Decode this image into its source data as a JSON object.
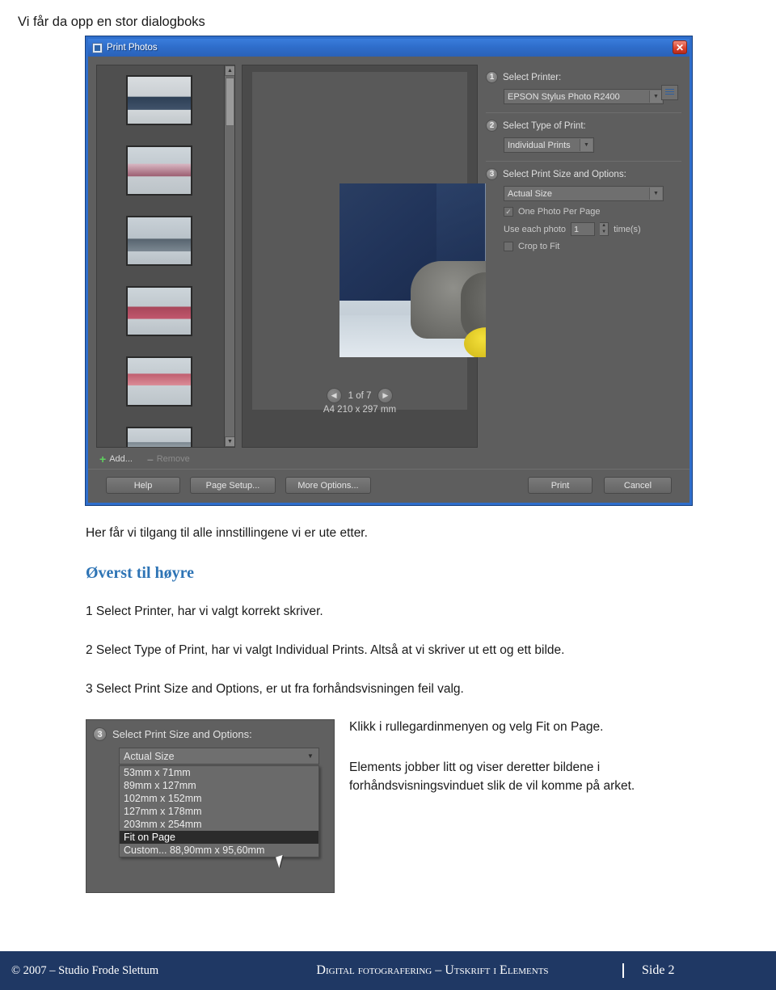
{
  "top_heading": "Vi får da opp en stor dialogboks",
  "dialog": {
    "title": "Print Photos",
    "close_label": "✕",
    "filmstrip": {
      "add_label": "Add...",
      "remove_label": "Remove"
    },
    "preview": {
      "page_indicator": "1 of 7",
      "page_size": "A4 210 x 297 mm",
      "prev_arrow": "◀",
      "next_arrow": "▶"
    },
    "sections": [
      {
        "number": "1",
        "title": "Select Printer:",
        "value": "EPSON Stylus Photo R2400"
      },
      {
        "number": "2",
        "title": "Select Type of Print:",
        "value": "Individual Prints"
      },
      {
        "number": "3",
        "title": "Select Print Size and Options:",
        "value": "Actual Size",
        "options": [
          {
            "label": "One Photo Per Page",
            "checked": "✓"
          },
          {
            "label": "Use each photo",
            "value": "1",
            "suffix": "time(s)"
          },
          {
            "label": "Crop to Fit",
            "checked": ""
          }
        ]
      }
    ],
    "buttons": {
      "help": "Help",
      "page_setup": "Page Setup...",
      "more_options": "More Options...",
      "print": "Print",
      "cancel": "Cancel"
    }
  },
  "body": {
    "p1": "Her får vi tilgang til alle innstillingene vi er ute etter.",
    "blue_heading": "Øverst til høyre",
    "p2": "1 Select Printer, har vi valgt korrekt skriver.",
    "p3": "2 Select Type of Print, har vi valgt Individual Prints. Altså at vi skriver ut ett og ett bilde.",
    "p4": "3 Select Print Size and Options, er ut fra forhåndsvisningen feil valg."
  },
  "dropdown_shot": {
    "number": "3",
    "title": "Select Print Size and Options:",
    "selected_value": "Actual Size",
    "items": [
      "53mm x 71mm",
      "89mm x 127mm",
      "102mm x 152mm",
      "127mm x 178mm",
      "203mm x 254mm",
      "Fit on Page",
      "Custom... 88,90mm x 95,60mm"
    ],
    "highlighted": "Fit on Page"
  },
  "side_notes": {
    "note1": "Klikk i rullegardinmenyen og velg Fit on Page.",
    "note2": "Elements jobber litt og viser deretter bildene i forhåndsvisningsvinduet slik de vil komme på arket."
  },
  "footer": {
    "left": "© 2007 – Studio Frode Slettum",
    "middle": "Digital fotografering – Utskrift i Elements",
    "right": "Side 2"
  }
}
